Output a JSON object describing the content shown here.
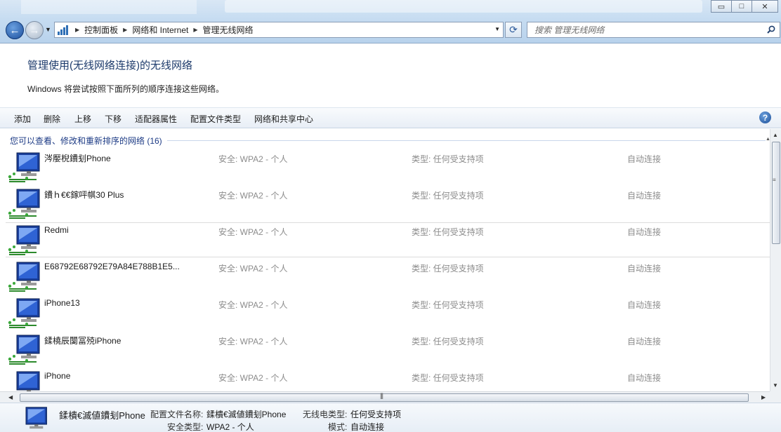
{
  "window": {
    "minimize": "▭",
    "maximize": "□",
    "close": "✕"
  },
  "address": {
    "crumbs": [
      "控制面板",
      "网络和 Internet",
      "管理无线网络"
    ]
  },
  "search": {
    "placeholder": "搜索 管理无线网络"
  },
  "header": {
    "title": "管理使用(无线网络连接)的无线网络",
    "description": "Windows 将尝试按照下面所列的顺序连接这些网络。"
  },
  "toolbar": {
    "add": "添加",
    "remove": "删除",
    "move_up": "上移",
    "move_down": "下移",
    "adapter_props": "适配器属性",
    "profile_types": "配置文件类型",
    "network_center": "网络和共享中心",
    "help": "?"
  },
  "group": {
    "header": "您可以查看、修改和重新排序的网络 (16)"
  },
  "networks": [
    {
      "name": "涔嬮棿鐨刬Phone",
      "security": "安全: WPA2 - 个人",
      "type": "类型: 任何受支持项",
      "mode": "自动连接"
    },
    {
      "name": "鐨ｈ€€鎵呯帺30 Plus",
      "security": "安全: WPA2 - 个人",
      "type": "类型: 任何受支持项",
      "mode": "自动连接"
    },
    {
      "name": "Redmi",
      "security": "安全: WPA2 - 个人",
      "type": "类型: 任何受支持项",
      "mode": "自动连接"
    },
    {
      "name": "E68792E68792E79A84E788B1E5...",
      "security": "安全: WPA2 - 个人",
      "type": "类型: 任何受支持项",
      "mode": "自动连接"
    },
    {
      "name": "iPhone13",
      "security": "安全: WPA2 - 个人",
      "type": "类型: 任何受支持项",
      "mode": "自动连接"
    },
    {
      "name": "鍒橈辰闅冨殑iPhone",
      "security": "安全: WPA2 - 个人",
      "type": "类型: 任何受支持项",
      "mode": "自动连接"
    },
    {
      "name": "iPhone",
      "security": "安全: WPA2 - 个人",
      "type": "类型: 任何受支持项",
      "mode": "自动连接"
    }
  ],
  "details": {
    "name": "鍒樻€滅値鐨刬Phone",
    "profile_label": "配置文件名称:",
    "profile_value": "鍒樻€滅値鐨刬Phone",
    "radio_label": "无线电类型:",
    "radio_value": "任何受支持项",
    "security_label": "安全类型:",
    "security_value": "WPA2 - 个人",
    "mode_label": "模式:",
    "mode_value": "自动连接"
  },
  "colors": {
    "title": "#1c3a6b",
    "group_header": "#1d3b85",
    "muted": "#8c8c8c"
  }
}
